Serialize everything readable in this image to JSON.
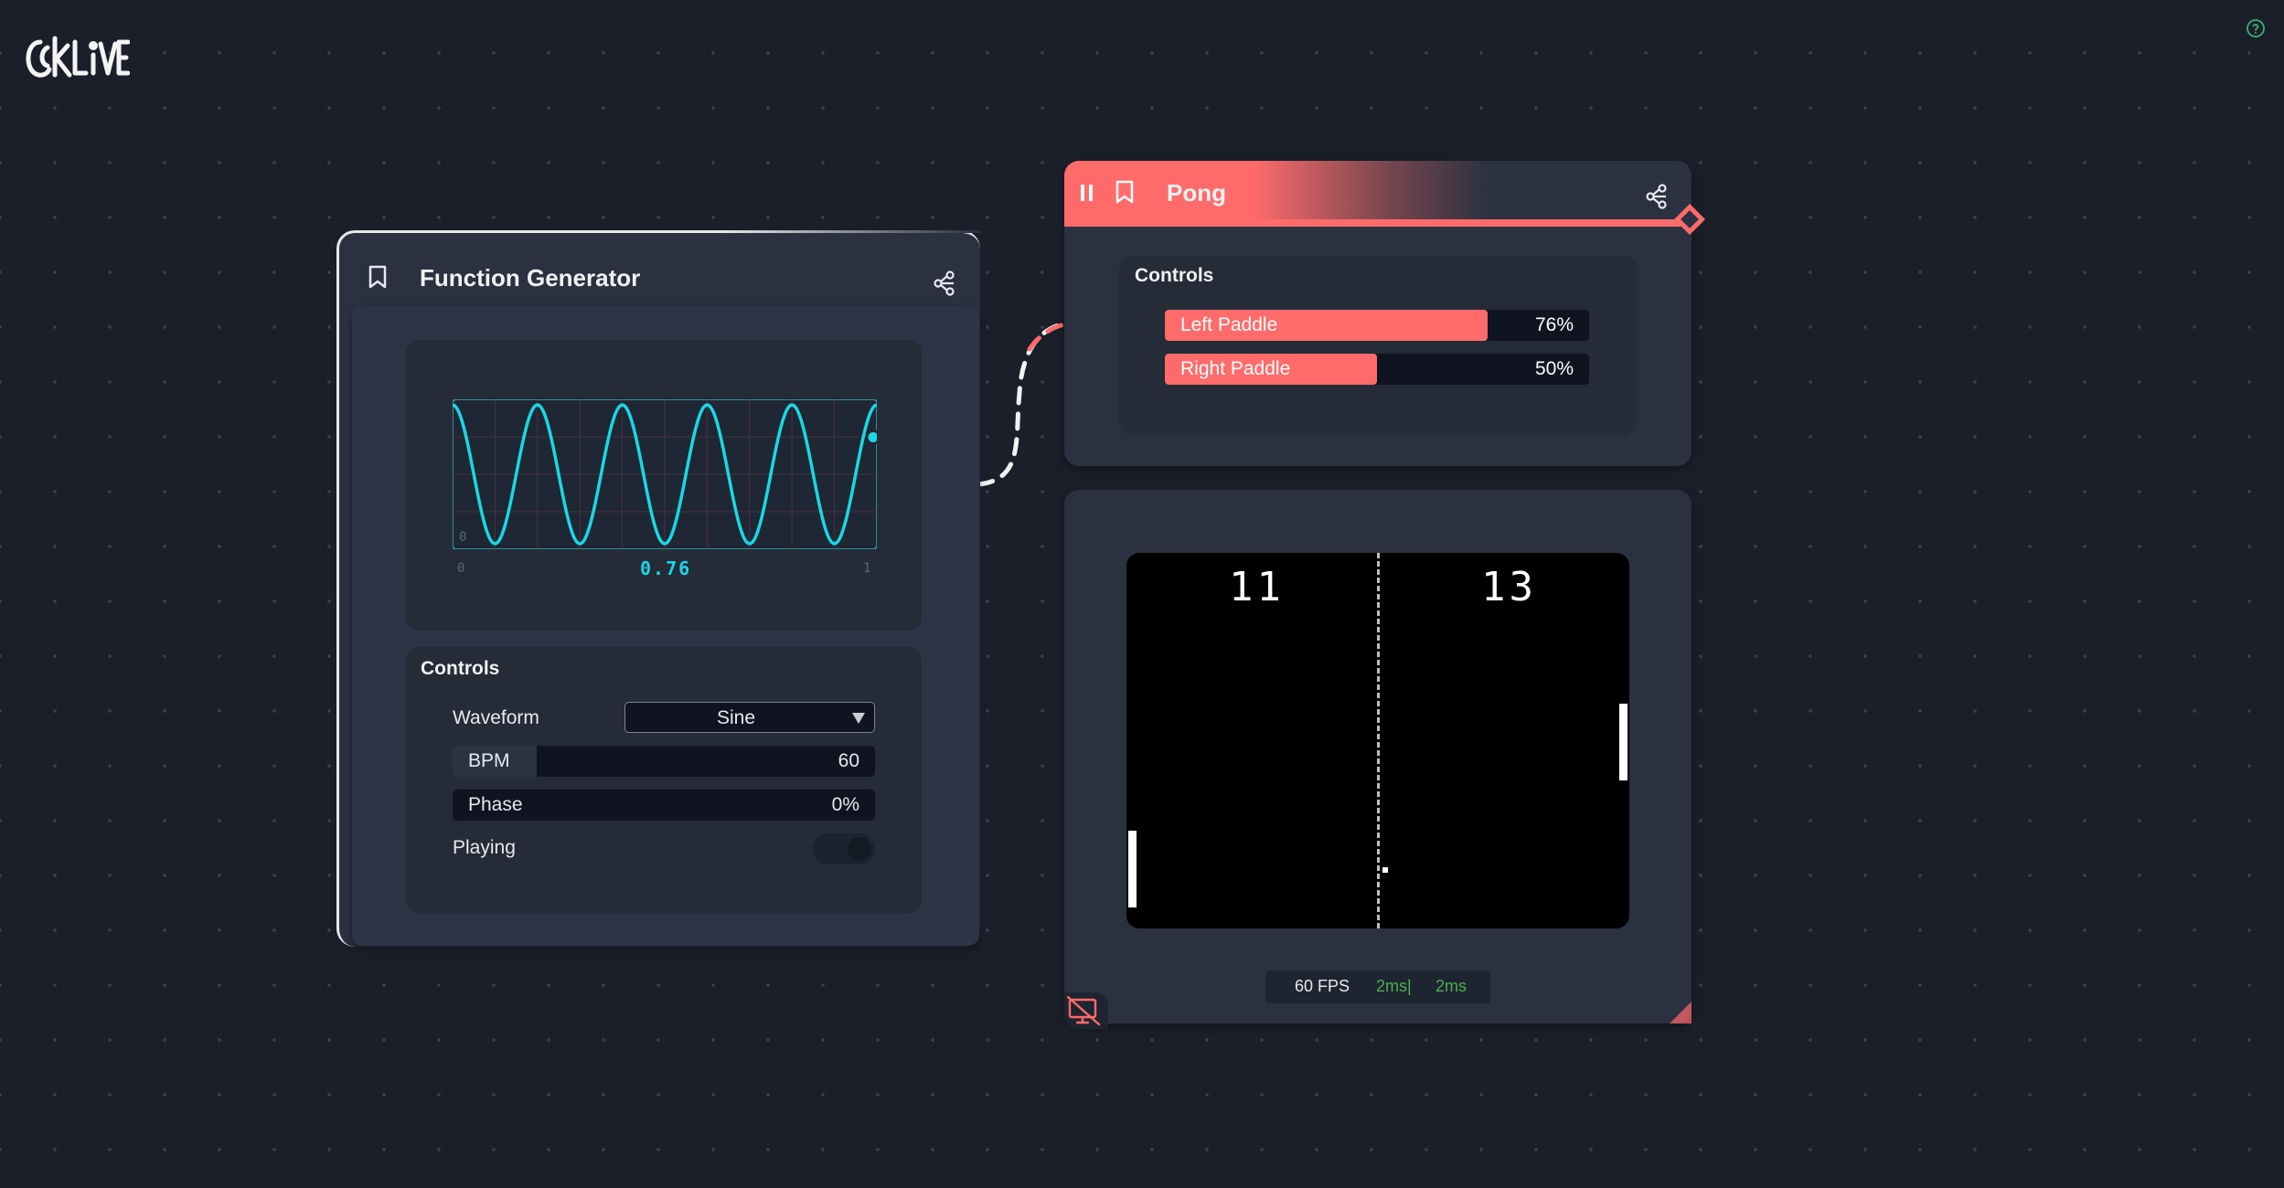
{
  "app": {
    "logo_text": "CKLIVE",
    "help_icon": "question-circle-icon",
    "accent_color": "#ff6b6b",
    "scope_color": "#18d8e4"
  },
  "function_generator": {
    "title": "Function Generator",
    "bookmark_icon": "bookmark-icon",
    "node_icon": "node-graph-icon",
    "scope": {
      "axis_min": "0",
      "axis_max": "1",
      "y_label": "0",
      "current_value": "0.76",
      "cycles_shown": 5
    },
    "controls": {
      "title": "Controls",
      "waveform_label": "Waveform",
      "waveform_value": "Sine",
      "bpm_label": "BPM",
      "bpm_value": "60",
      "bpm_fill_fraction": 0.2,
      "phase_label": "Phase",
      "phase_value": "0%",
      "playing_label": "Playing",
      "playing_on": false
    }
  },
  "pong": {
    "title": "Pong",
    "pause_icon": "pause-icon",
    "bookmark_icon": "bookmark-icon",
    "node_icon": "node-graph-icon",
    "controls": {
      "title": "Controls",
      "left_paddle_label": "Left Paddle",
      "left_paddle_value": "76%",
      "left_paddle_fraction": 0.76,
      "right_paddle_label": "Right Paddle",
      "right_paddle_value": "50%",
      "right_paddle_fraction": 0.5
    },
    "game": {
      "left_score": "11",
      "right_score": "13"
    },
    "stats": {
      "fps": "60 FPS",
      "frame_time_1": "2ms|",
      "frame_time_2": "2ms"
    },
    "screen_icon": "screen-off-icon"
  }
}
